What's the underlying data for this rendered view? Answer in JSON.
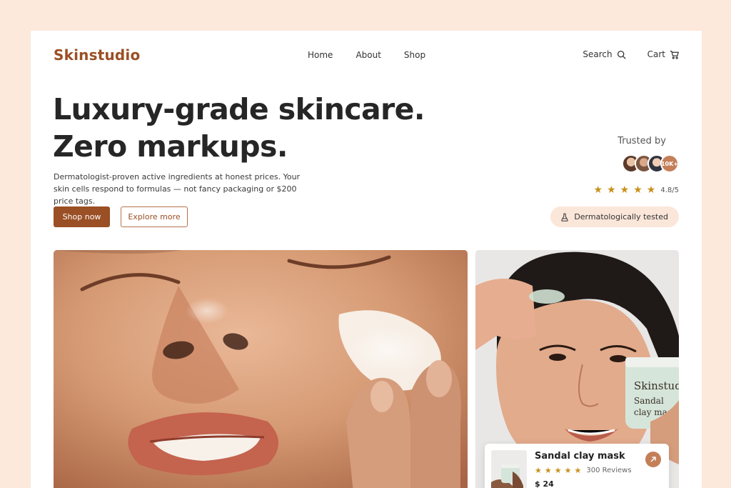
{
  "brand": {
    "name": "Skinstudio",
    "color": "#9a4f24",
    "accent": "#c47f59"
  },
  "nav": {
    "items": [
      "Home",
      "About",
      "Shop"
    ]
  },
  "utility": {
    "search_label": "Search",
    "search_icon": "search-icon",
    "cart_label": "Cart",
    "cart_icon": "cart-icon"
  },
  "hero": {
    "title_line1": "Luxury-grade skincare.",
    "title_line2": "Zero markups.",
    "subtitle": "Dermatologist-proven active ingredients at honest prices. Your skin cells respond to formulas — not fancy packaging or $200 price tags.",
    "primary_cta": "Shop now",
    "secondary_cta": "Explore more"
  },
  "trust": {
    "label": "Trusted by",
    "count_badge": "10K+",
    "rating_value": "4.8/5",
    "stars": 5,
    "badge_label": "Dermatologically tested",
    "badge_icon": "flask-icon"
  },
  "product_card": {
    "name": "Sandal clay mask",
    "stars": 5,
    "reviews": "300 Reviews",
    "price": "$ 24",
    "jar_brand": "Skinstudio",
    "jar_line1": "Sandal",
    "jar_line2": "clay mask",
    "button_icon": "arrow-up-right-icon"
  },
  "colors": {
    "page_bg": "#fde8dc",
    "star": "#c8901a",
    "badge_bg": "#fbe6da"
  }
}
